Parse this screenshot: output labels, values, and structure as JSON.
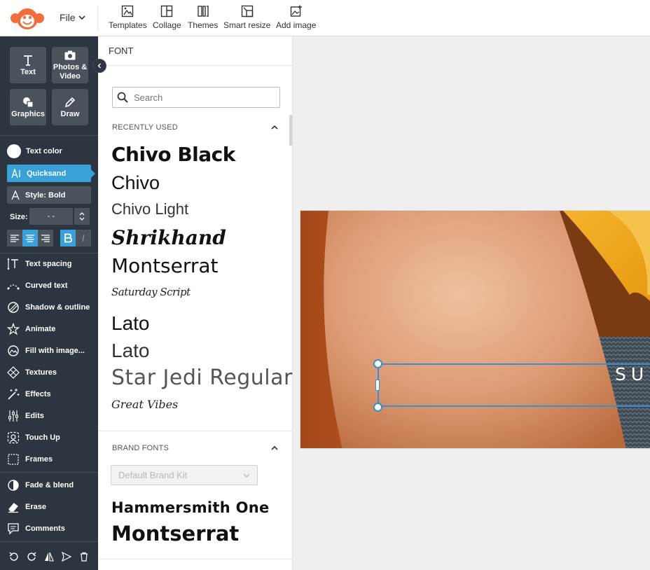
{
  "topbar": {
    "file_label": "File",
    "tools": [
      {
        "label": "Templates",
        "icon": "templates-icon"
      },
      {
        "label": "Collage",
        "icon": "collage-icon"
      },
      {
        "label": "Themes",
        "icon": "themes-icon"
      },
      {
        "label": "Smart resize",
        "icon": "smart-resize-icon"
      },
      {
        "label": "Add image",
        "icon": "add-image-icon"
      }
    ]
  },
  "sidebar": {
    "buttons": [
      {
        "label": "Text",
        "icon": "text-icon"
      },
      {
        "label": "Photos & Video",
        "icon": "camera-icon"
      },
      {
        "label": "Graphics",
        "icon": "graphics-icon"
      },
      {
        "label": "Draw",
        "icon": "draw-icon"
      }
    ],
    "text_color_label": "Text color",
    "font_label": "Quicksand",
    "style_label": "Style: Bold",
    "size_label": "Size:",
    "size_value": "- -",
    "items": [
      {
        "label": "Text spacing",
        "icon": "text-spacing-icon"
      },
      {
        "label": "Curved text",
        "icon": "curved-text-icon"
      },
      {
        "label": "Shadow & outline",
        "icon": "shadow-outline-icon"
      },
      {
        "label": "Animate",
        "icon": "animate-icon"
      },
      {
        "label": "Fill with image...",
        "icon": "fill-image-icon"
      },
      {
        "label": "Textures",
        "icon": "textures-icon"
      },
      {
        "label": "Effects",
        "icon": "effects-icon"
      },
      {
        "label": "Edits",
        "icon": "edits-icon"
      },
      {
        "label": "Touch Up",
        "icon": "touch-up-icon"
      },
      {
        "label": "Frames",
        "icon": "frames-icon"
      },
      {
        "label": "Fade & blend",
        "icon": "fade-blend-icon"
      },
      {
        "label": "Erase",
        "icon": "erase-icon"
      },
      {
        "label": "Comments",
        "icon": "comments-icon"
      }
    ]
  },
  "panel": {
    "title": "FONT",
    "search_placeholder": "Search",
    "recently_used_label": "RECENTLY USED",
    "recent_fonts": [
      "Chivo Black",
      "Chivo",
      "Chivo Light",
      "Shrikhand",
      "Montserrat",
      "Saturday Script",
      "Lato",
      "Lato",
      "Star Jedi Regular",
      "Great Vibes"
    ],
    "brand_fonts_label": "BRAND FONTS",
    "brand_kit_placeholder": "Default Brand Kit",
    "brand_fonts": [
      "Hammersmith One",
      "Montserrat"
    ]
  },
  "canvas": {
    "text": "SU"
  },
  "colors": {
    "accent": "#3aa0d8",
    "sidebar_bg": "#2d3540",
    "selection": "#3b8fd0"
  }
}
